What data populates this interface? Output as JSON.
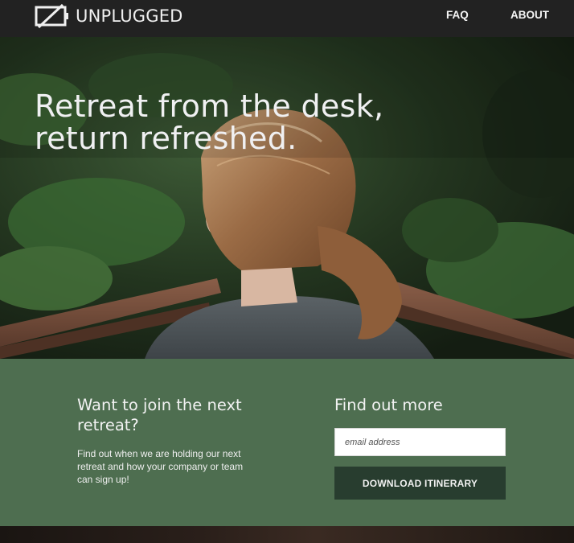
{
  "brand": {
    "name": "UNPLUGGED",
    "icon": "unplugged-battery-icon"
  },
  "nav": {
    "links": [
      {
        "label": "FAQ"
      },
      {
        "label": "ABOUT"
      }
    ]
  },
  "hero": {
    "title_line1": "Retreat from the desk,",
    "title_line2": "return refreshed.",
    "image": "woman-on-forest-bridge-photo"
  },
  "cta": {
    "heading": "Want to join the next retreat?",
    "body": "Find out when we are holding our next retreat and how your company or team can sign up!",
    "form_heading": "Find out more",
    "email_placeholder": "email address",
    "email_value": "",
    "button_label": "DOWNLOAD ITINERARY"
  },
  "colors": {
    "nav_bg": "#222222",
    "cta_bg": "#4e6e50",
    "button_bg": "#283d2f",
    "text_light": "#f2f2f2"
  }
}
